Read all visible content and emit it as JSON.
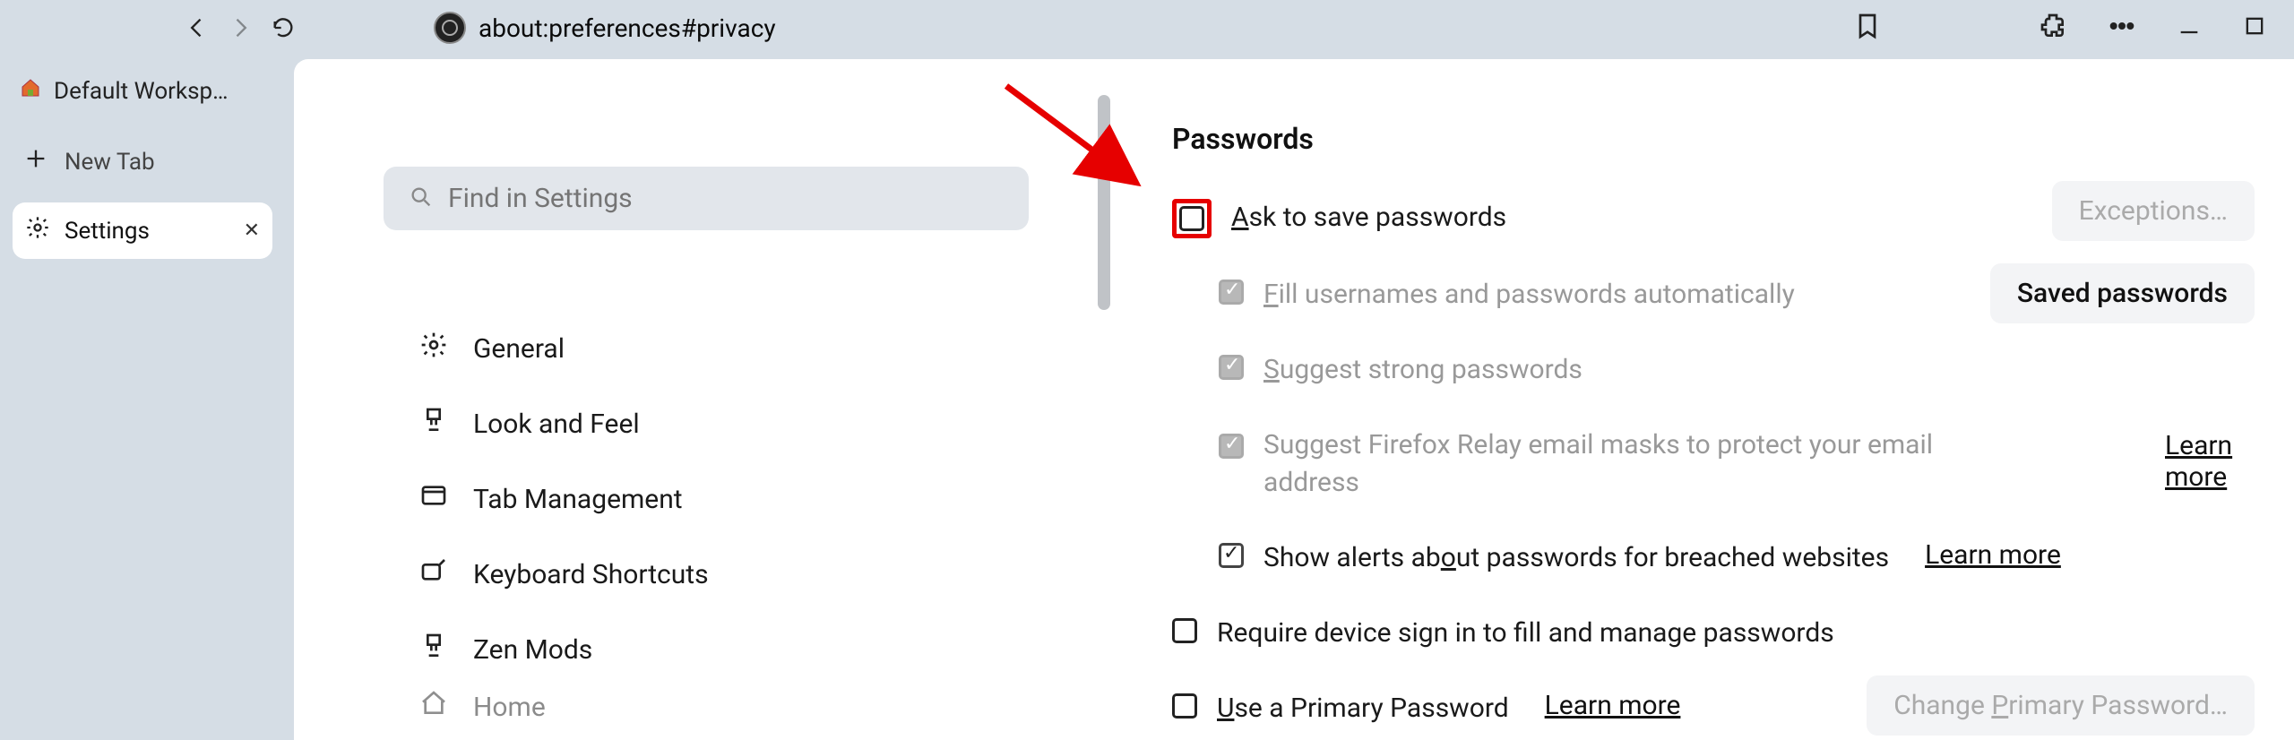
{
  "toolbar": {
    "url": "about:preferences#privacy"
  },
  "sidebar": {
    "workspace": "Default Worksp…",
    "newtab": "New Tab",
    "active_tab": "Settings"
  },
  "settings_nav": {
    "search_placeholder": "Find in Settings",
    "items": [
      {
        "label": "General"
      },
      {
        "label": "Look and Feel"
      },
      {
        "label": "Tab Management"
      },
      {
        "label": "Keyboard Shortcuts"
      },
      {
        "label": "Zen Mods"
      },
      {
        "label": "Home"
      }
    ]
  },
  "main": {
    "section_title": "Passwords",
    "options": {
      "ask_save": "Ask to save passwords",
      "fill_auto": "Fill usernames and passwords automatically",
      "suggest_strong": "Suggest strong passwords",
      "relay_masks": "Suggest Firefox Relay email masks to protect your email address",
      "breached_alerts": "Show alerts about passwords for breached websites",
      "require_signin": "Require device sign in to fill and manage passwords",
      "primary_password": "Use a Primary Password"
    },
    "buttons": {
      "exceptions": "Exceptions…",
      "saved_passwords": "Saved passwords",
      "learn_more": "Learn more",
      "change_primary": "Change Primary Password…"
    }
  }
}
